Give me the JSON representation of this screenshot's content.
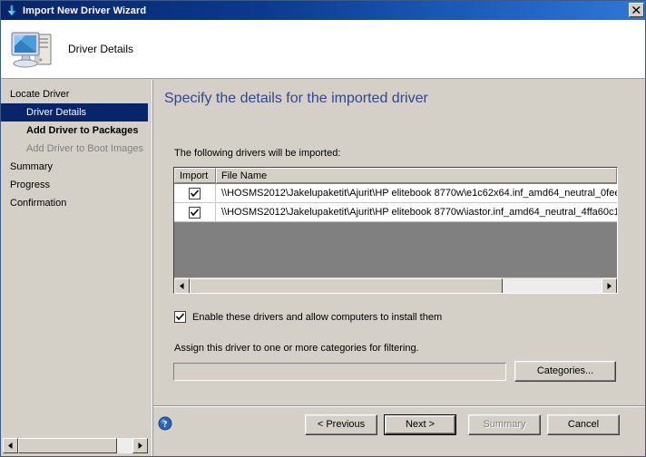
{
  "window": {
    "title": "Import New Driver Wizard",
    "title_icon": "import-arrow-icon",
    "close_label": "✕"
  },
  "banner": {
    "title": "Driver Details",
    "icon": "computer-icon"
  },
  "sidebar": {
    "steps": [
      {
        "label": "Locate Driver",
        "state": "normal",
        "indent": false
      },
      {
        "label": "Driver Details",
        "state": "selected",
        "indent": true
      },
      {
        "label": "Add Driver to Packages",
        "state": "bold",
        "indent": true
      },
      {
        "label": "Add Driver to Boot Images",
        "state": "disabled",
        "indent": true
      },
      {
        "label": "Summary",
        "state": "normal",
        "indent": false
      },
      {
        "label": "Progress",
        "state": "normal",
        "indent": false
      },
      {
        "label": "Confirmation",
        "state": "normal",
        "indent": false
      }
    ]
  },
  "main": {
    "heading": "Specify the details for the imported driver",
    "list_label": "The following drivers will be imported:",
    "table": {
      "columns": [
        "Import",
        "File Name"
      ],
      "rows": [
        {
          "import_checked": true,
          "file_name": "\\\\HOSMS2012\\Jakelupaketit\\Ajurit\\HP elitebook 8770w\\e1c62x64.inf_amd64_neutral_0fee"
        },
        {
          "import_checked": true,
          "file_name": "\\\\HOSMS2012\\Jakelupaketit\\Ajurit\\HP elitebook 8770w\\iastor.inf_amd64_neutral_4ffa60c1"
        }
      ]
    },
    "enable_checkbox": {
      "label": "Enable these drivers and allow computers to install them",
      "checked": true
    },
    "assign_label": "Assign this driver to one or more categories for filtering.",
    "category_field_value": "",
    "categories_button": "Categories..."
  },
  "footer": {
    "help_icon": "help-question-icon",
    "buttons": {
      "previous": "< Previous",
      "next": "Next >",
      "summary": "Summary",
      "cancel": "Cancel"
    }
  },
  "colors": {
    "titlebar_start": "#0a246a",
    "titlebar_end": "#2f77d8",
    "dialog_face": "#d4d0c8",
    "heading_blue": "#31478f",
    "selection_blue": "#08246b",
    "list_empty_gray": "#808080"
  }
}
